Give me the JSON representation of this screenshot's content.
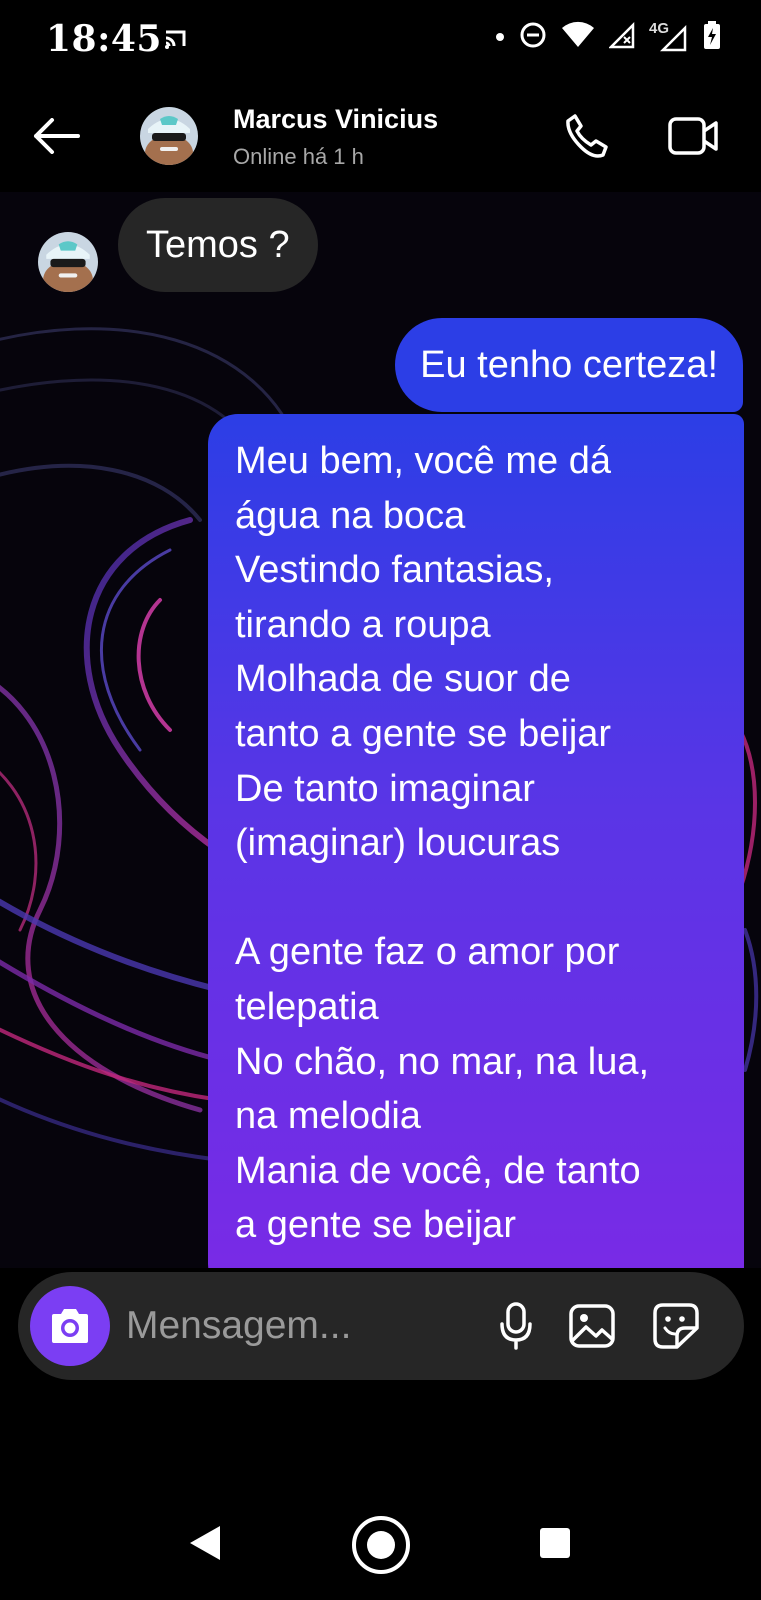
{
  "status_bar": {
    "time": "18:45",
    "network_label": "4G",
    "icons": [
      "cast-icon",
      "notification-dot-icon",
      "do-not-disturb-icon",
      "wifi-icon",
      "signal-no-data-icon",
      "signal-4g-icon",
      "battery-charging-icon"
    ]
  },
  "header": {
    "contact_name": "Marcus Vinicius",
    "contact_status": "Online há 1 h",
    "icons": [
      "back-arrow-icon",
      "phone-icon",
      "video-camera-icon"
    ]
  },
  "messages": [
    {
      "direction": "incoming",
      "text": "Temos ?"
    },
    {
      "direction": "outgoing",
      "text": "Eu tenho certeza!"
    },
    {
      "direction": "outgoing",
      "lines": [
        "Meu bem, você me dá",
        "água na boca",
        "Vestindo fantasias,",
        "tirando a roupa",
        "Molhada de suor de",
        "tanto a gente se beijar",
        "De tanto imaginar",
        "(imaginar) loucuras",
        "",
        "A gente faz o amor por",
        "telepatia",
        "No chão, no mar, na lua,",
        "na melodia",
        "Mania de você, de tanto",
        "a gente se beijar"
      ]
    }
  ],
  "composer": {
    "placeholder": "Mensagem...",
    "value": "",
    "icons": [
      "camera-icon",
      "microphone-icon",
      "gallery-icon",
      "sticker-icon"
    ]
  },
  "colors": {
    "background": "#000000",
    "incoming_bubble": "#262626",
    "outgoing_gradient_start": "#2c3ee6",
    "outgoing_gradient_end": "#7a2ae6",
    "camera_button": "#7b3ef3",
    "secondary_text": "#a8a8a8"
  }
}
